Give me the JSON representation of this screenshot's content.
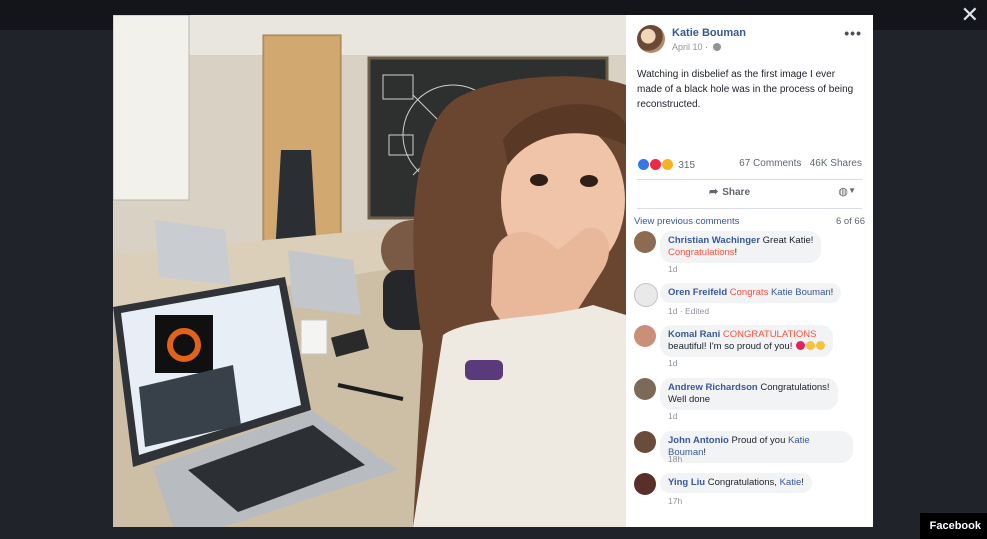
{
  "viewer": {
    "close_glyph": "✕",
    "watermark": "Facebook"
  },
  "post": {
    "author": "Katie Bouman",
    "date": "April 10",
    "more_glyph": "•••",
    "text": "Watching in disbelief as the first image I ever made of a black hole was in the process of being reconstructed.",
    "reaction_count": "315",
    "comments_count": "67 Comments",
    "shares_count": "46K Shares",
    "share_label": "Share",
    "reactions": [
      "like-icon",
      "love-icon",
      "wow-icon"
    ],
    "accent_color": "#385898"
  },
  "comments_header": {
    "view_previous": "View previous comments",
    "count": "6 of 66"
  },
  "comments": [
    {
      "name": "Christian Wachinger",
      "text_before": "Great Katie!",
      "emphasis": "Congratulations",
      "text_after": "!",
      "time": "1d"
    },
    {
      "name": "Oren Freifeld",
      "emphasis": "Congrats",
      "mention": "Katie Bouman",
      "text_after": "!",
      "time": "1d · Edited"
    },
    {
      "name": "Komal Rani",
      "emphasis": "CONGRATULATIONS",
      "text_line2": "beautiful! I'm so proud of you!",
      "time": "1d"
    },
    {
      "name": "Andrew Richardson",
      "text_before": "Congratulations!",
      "text_line2": "Well done",
      "time": "1d"
    },
    {
      "name": "John Antonio",
      "text_before": "Proud of you",
      "mention": "Katie Bouman",
      "text_after": "!",
      "time": "18h"
    },
    {
      "name": "Ying Liu",
      "text_before": "Congratulations,",
      "mention": "Katie",
      "text_after": "!",
      "time": "17h"
    }
  ]
}
